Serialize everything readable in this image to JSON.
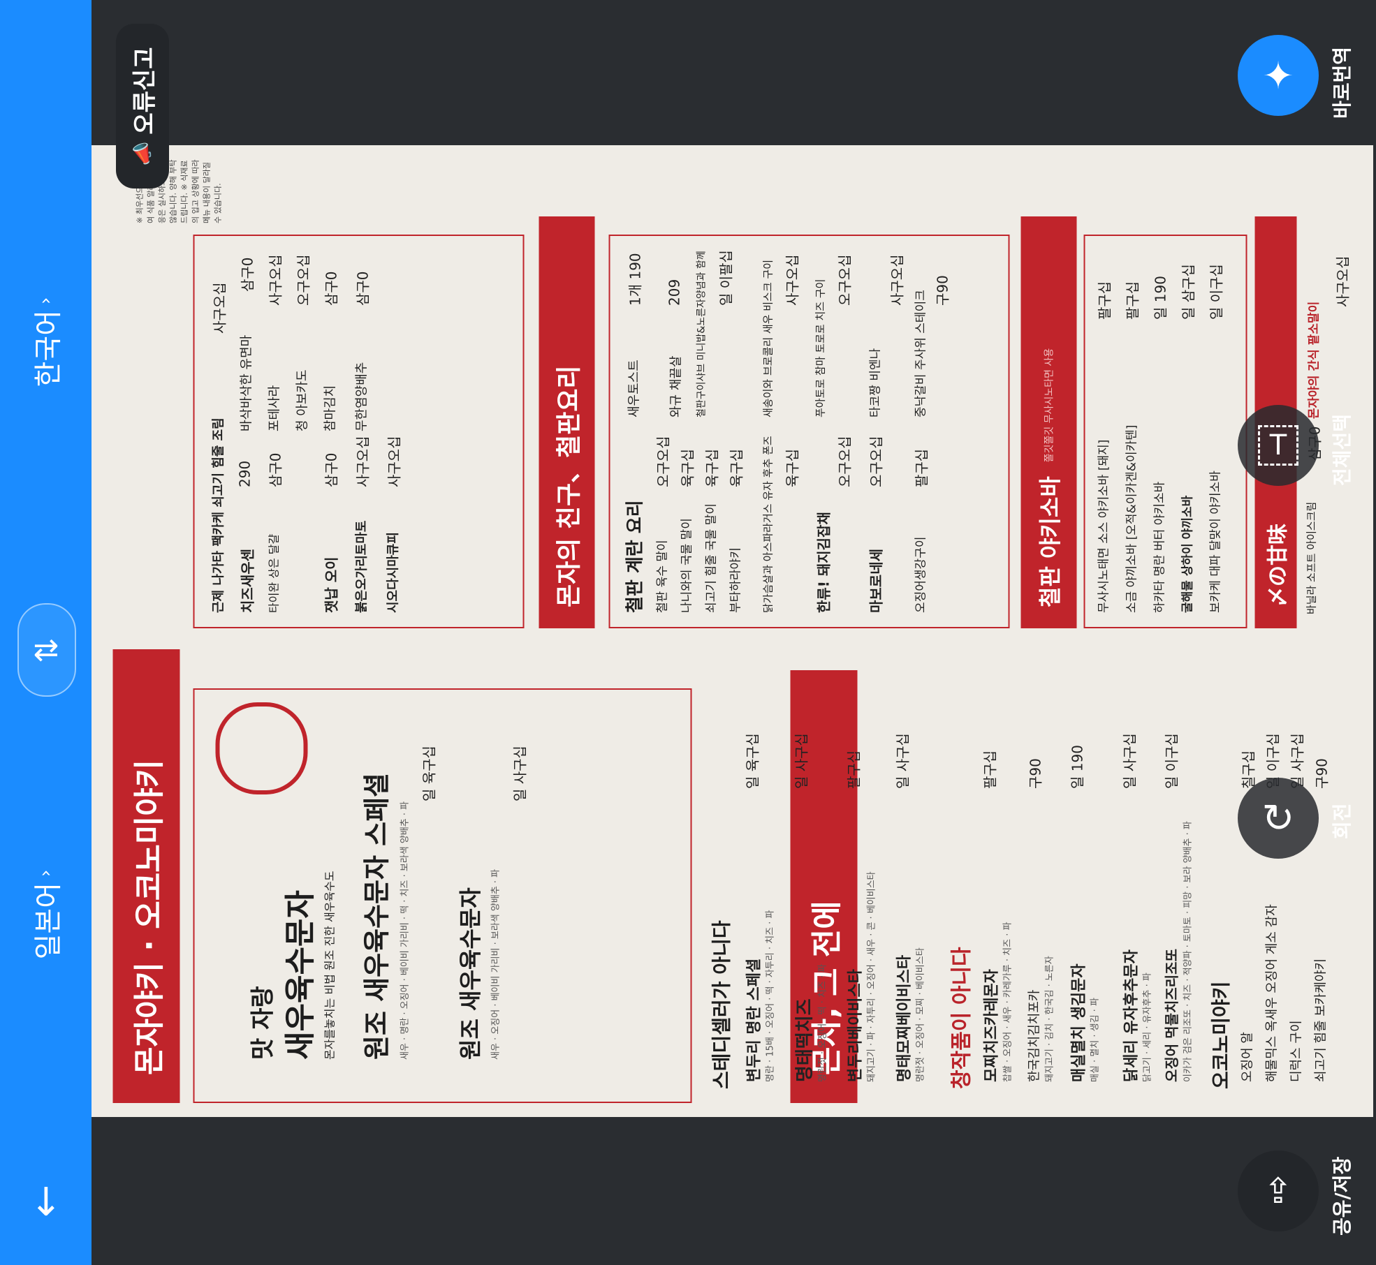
{
  "lang": {
    "source": "한국어",
    "target": "일본어",
    "swap_icon": "swap-icon",
    "down_icon": "arrow-down-icon"
  },
  "report": {
    "label": "오류신고"
  },
  "actions": {
    "instant_translate": "바로번역",
    "select_all": "전체선택",
    "rotate": "회전",
    "share_save": "공유/저장"
  },
  "menu": {
    "band_top": "몬자야키 · 오코노미야키",
    "band_bottom": "몬자, 그 전에",
    "signature": {
      "heading1": "맛 자랑",
      "heading2": "새우육수문자",
      "subtitle": "몬자를놓치는 비법 원조 진한 새우육수도",
      "item1": "원조 새우육수문자 스페셜",
      "item1_desc": "새우 · 명란 · 오징어 · 베이비 가리비 · 떡 · 치즈 · 보라색 양배추 · 파",
      "item1_price": "일 육구십",
      "item2": "원조 새우육수문자",
      "item2_desc": "새우 · 오징어 · 베이비 가리비 · 보라색 양배추 · 파",
      "item2_price": "일 사구십"
    },
    "not_steady": {
      "heading": "스테디셀러가 아니다",
      "items": [
        {
          "name": "변두리 명란 스페셜",
          "desc": "명란 · 15배 · 오징어 · 떡 · 자투리 · 치즈 · 파",
          "price": "일 육구십"
        },
        {
          "name": "명태떡치즈",
          "desc": "명란젓 · 오징어 · 떡 · 치즈 · 파",
          "price": "일 사구십"
        },
        {
          "name": "변두리베이비스타",
          "desc": "돼지고기 · 파 · 자투리 · 오징어 · 새우 · 콘 · 베이비스타",
          "price": "팔구십"
        },
        {
          "name": "명태모찌베이비스타",
          "desc": "명란젓 · 오징어 · 모찌 · 베이비스타",
          "price": "일 사구십"
        }
      ]
    },
    "creative": {
      "heading": "창작품이 아니다",
      "items": [
        {
          "name": "모찌치즈카레몬자",
          "desc": "찹쌀 · 오징어 · 새우 · 카레가루 · 치즈 · 파",
          "price": "팔구십"
        },
        {
          "name": "한국김치김치포카",
          "desc": "돼지고기 · 김치 · 한국김 · 노른자",
          "price": "구90"
        },
        {
          "name": "매실멸치 생김문자",
          "desc": "매실 · 멸치 · 생김 · 파",
          "price": "일 190"
        },
        {
          "name": "닭세리 유자후추문자",
          "desc": "닭고기 · 세리 · 유자후추 · 파",
          "price": "일 사구십"
        },
        {
          "name": "오징어 먹물치즈리조또",
          "desc": "이카가 검은 리조또 · 치즈 · 적양파 · 토마토 · 피망 · 보라 양배추 · 파",
          "price": "일 이구십"
        }
      ]
    },
    "okonomi": {
      "heading": "오코노미야키",
      "items": [
        {
          "name": "오징어 알",
          "price": "칠구십"
        },
        {
          "name": "해물믹스 옥새우 오징어 게소 감자",
          "price": "일 이구십"
        },
        {
          "name": "디럭스 구이",
          "price": "일 사구십"
        },
        {
          "name": "쇠고기 힘줄 보카케야키",
          "price": "구90"
        }
      ]
    },
    "before": {
      "items": [
        {
          "name": "근제 나가타 팩카케 쇠고기 힘줄 조림",
          "price": "사구오십"
        },
        {
          "name": "치즈새우센",
          "price": "290"
        },
        {
          "name": "바삭바삭한 유면마",
          "price": "삼구0"
        },
        {
          "name": "타이완 상은 달걀",
          "price": "삼구0"
        },
        {
          "name": "포테사라",
          "price": "사구오십"
        },
        {
          "name": "청 아보카도",
          "price": "오구오십"
        },
        {
          "name": "잿납 오이",
          "price": "삼구0"
        },
        {
          "name": "참마김치",
          "price": "삼구0"
        },
        {
          "name": "붉은오가리토마토",
          "price": "사구오십"
        },
        {
          "name": "무한염양배추",
          "price": "삼구0"
        },
        {
          "name": "시오다시마큐피",
          "price": "사구오십"
        }
      ]
    },
    "friends": {
      "heading": "몬자의 친구、철판요리",
      "items": [
        {
          "name": "철판 계란 요리",
          "price": ""
        },
        {
          "name": "철판 육수 말이",
          "price": "오구오십"
        },
        {
          "name": "나니와의 국물 말이",
          "price": "육구십"
        },
        {
          "name": "쇠고기 힘줄 국물 말이",
          "price": "육구십"
        },
        {
          "name": "부타하라야키",
          "price": "육구십"
        },
        {
          "name": "새우토스트",
          "price": "1개 190"
        },
        {
          "name": "와규 채끝살",
          "price": "209"
        },
        {
          "name": "철판구이샤브 미니밥&노른자양념과 함께",
          "price": "일 이팔십"
        },
        {
          "name": "닭가슴살과 아스파라거스 유자 후추 폰즈",
          "price": "육구십"
        },
        {
          "name": "새송이와 브로콜리 새우 비스크 구이",
          "price": "사구오십"
        },
        {
          "name": "한류! 돼지김잡채",
          "price": "오구오십"
        },
        {
          "name": "푸아토로 참마 토로로 치즈 구이",
          "price": "오구오십"
        },
        {
          "name": "마보로네세",
          "price": "오구오십"
        },
        {
          "name": "타코짱 비엔나",
          "price": "사구오십"
        },
        {
          "name": "오징어생강구이",
          "price": "팔구십"
        },
        {
          "name": "중낙갈비 주사위 스테이크",
          "price": "구90"
        }
      ]
    },
    "yakisoba": {
      "heading": "철판 야키소바",
      "sub": "쫄깃쫄깃 무사시노타면 사용",
      "items": [
        {
          "name": "무사시노태면 소스 야키소바 [돼지]",
          "price": "팔구십"
        },
        {
          "name": "소금 야끼소바 [오적&이카겐&이카텐]",
          "price": "팔구십"
        },
        {
          "name": "하카타 명란 버터 야키소바",
          "price": "일 190"
        },
        {
          "name": "굴해물 상하이 야끼소바",
          "price": "일 삼구십"
        },
        {
          "name": "보카케 대파 달맞이 야키소바",
          "price": "일 이구십"
        }
      ]
    },
    "sweet": {
      "heading": "〆の甘味",
      "items": [
        {
          "name": "바닐라 소프트 아이스크림",
          "price": "삼구0"
        },
        {
          "name": "몬자야의 간식 팥소말이",
          "price": "사구오십"
        }
      ]
    },
    "footer": "※ 최우선으로 생각하여 식품 알레르기 대응은 실시하고 있지 않습니다. 양해 부탁드립니다. ※ 식재료의 입고 상황에 따라 메뉴 내용이 달라질 수 있습니다."
  },
  "colors": {
    "accent_blue": "#1b8cff",
    "menu_red": "#c0242b",
    "dark_bg": "#2a2d31"
  }
}
